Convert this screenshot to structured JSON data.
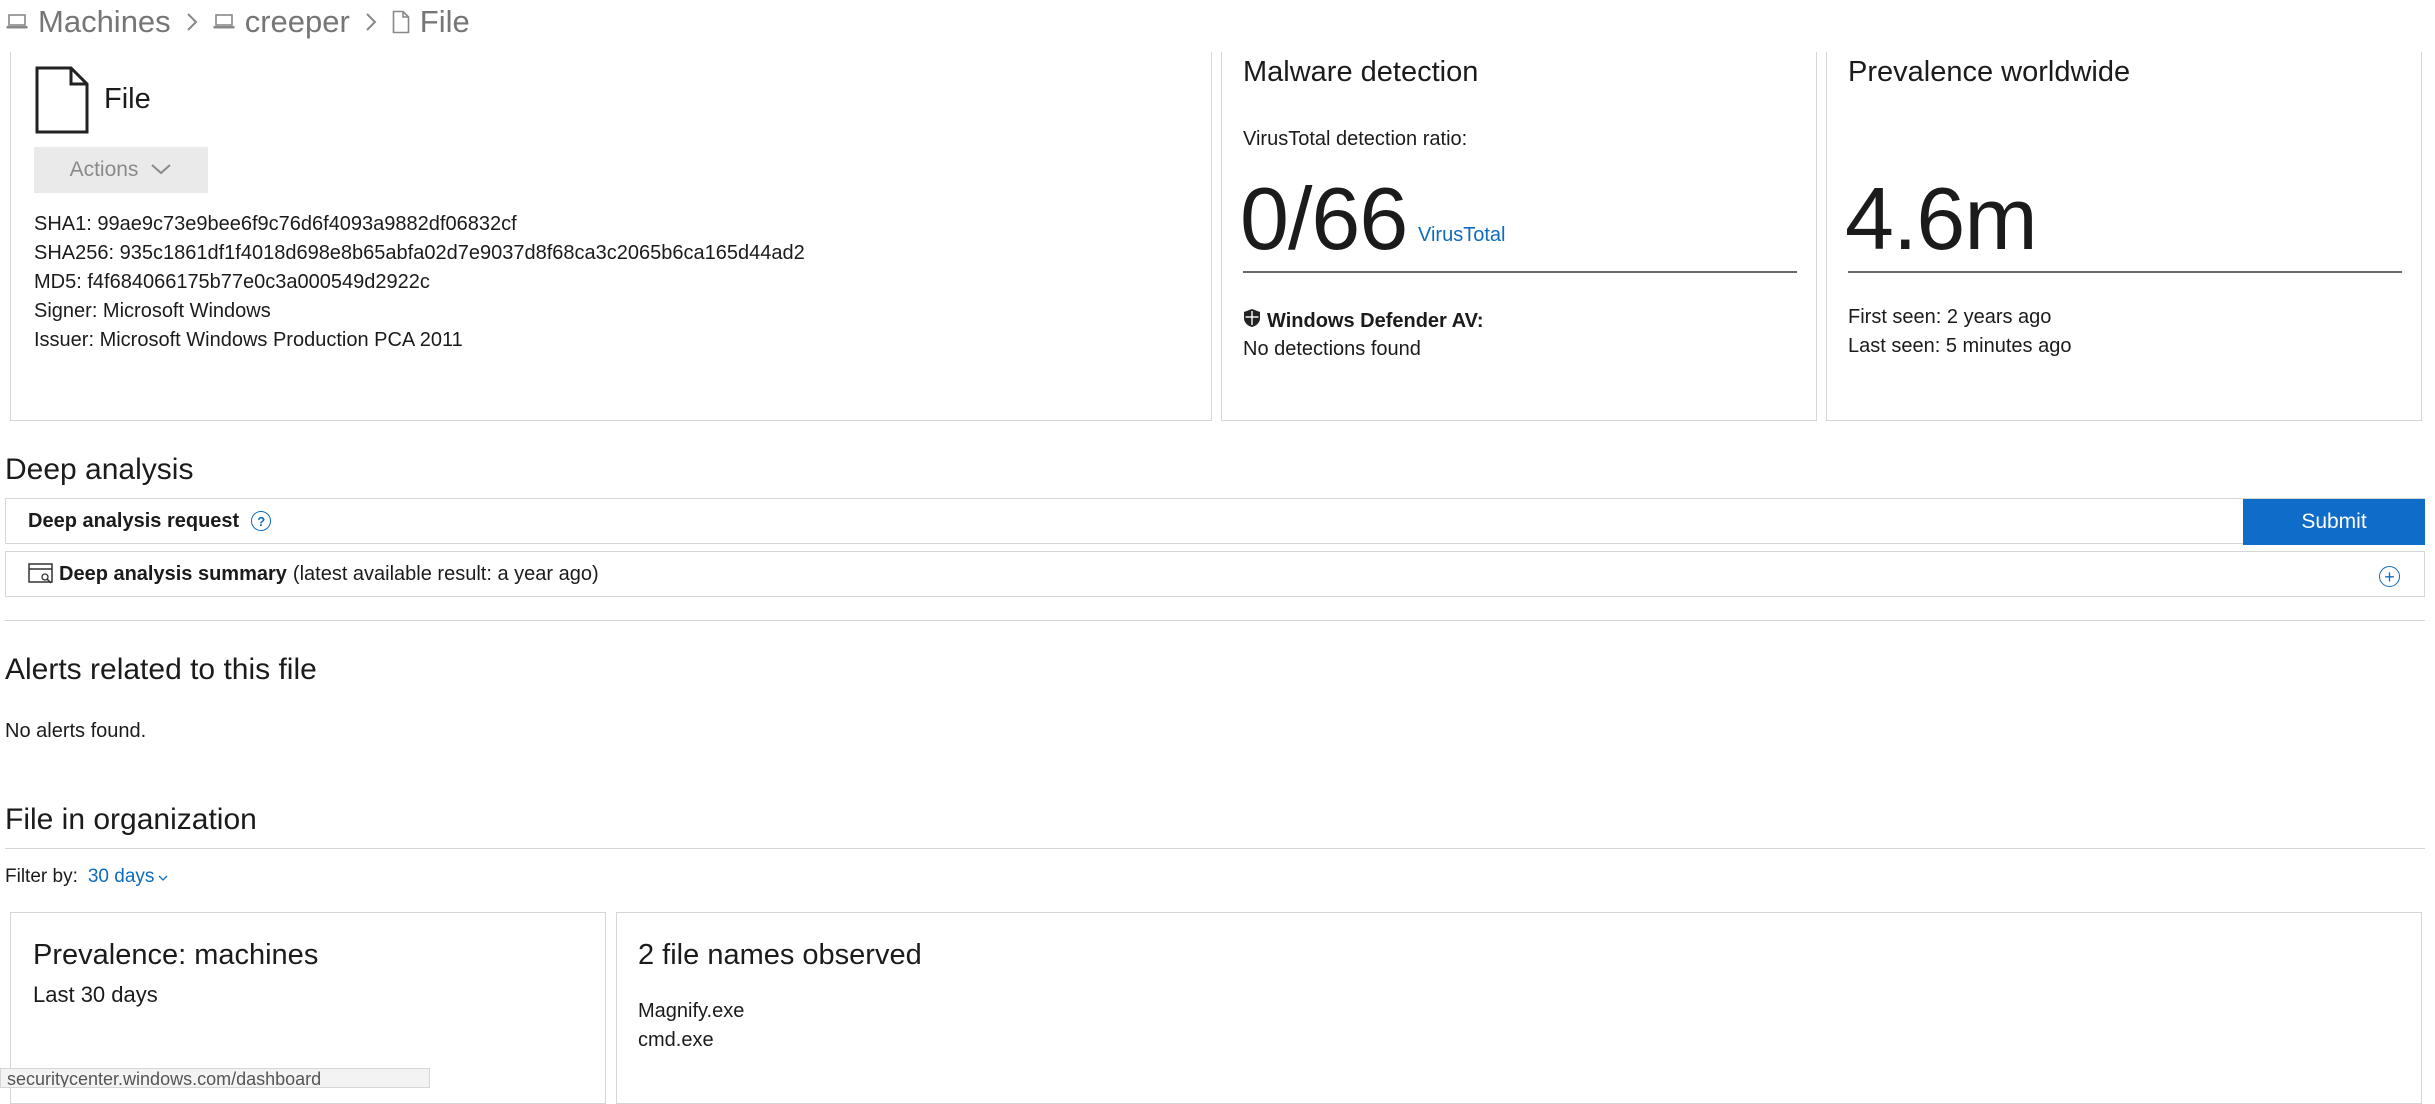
{
  "breadcrumb": {
    "items": [
      {
        "label": "Machines",
        "icon": "laptop-icon"
      },
      {
        "label": "creeper",
        "icon": "laptop-icon"
      },
      {
        "label": "File",
        "icon": "file-icon"
      }
    ]
  },
  "file_card": {
    "title": "File",
    "actions_label": "Actions",
    "details": [
      "SHA1: 99ae9c73e9bee6f9c76d6f4093a9882df06832cf",
      "SHA256: 935c1861df1f4018d698e8b65abfa02d7e9037d8f68ca3c2065b6ca165d44ad2",
      "MD5: f4f684066175b77e0c3a000549d2922c",
      "Signer: Microsoft Windows",
      "Issuer: Microsoft Windows Production PCA 2011"
    ]
  },
  "malware_card": {
    "title": "Malware detection",
    "ratio_label": "VirusTotal detection ratio:",
    "ratio_value": "0/66",
    "virustotal_link": "VirusTotal",
    "defender_label": "Windows Defender AV:",
    "defender_result": "No detections found"
  },
  "prevalence_card": {
    "title": "Prevalence worldwide",
    "value": "4.6m",
    "first_seen": "First seen: 2 years ago",
    "last_seen": "Last seen: 5 minutes ago"
  },
  "deep_analysis": {
    "section_title": "Deep analysis",
    "request_label": "Deep analysis request",
    "submit_label": "Submit",
    "summary_label": "Deep analysis summary",
    "summary_note": "(latest available result: a year ago)"
  },
  "alerts": {
    "section_title": "Alerts related to this file",
    "empty_text": "No alerts found."
  },
  "org": {
    "section_title": "File in organization",
    "filter_label": "Filter by:",
    "filter_value": "30 days",
    "machines_card": {
      "title": "Prevalence: machines",
      "subtitle": "Last 30 days"
    },
    "names_card": {
      "title": "2 file names observed",
      "names": [
        "Magnify.exe",
        "cmd.exe"
      ]
    }
  },
  "statusbar": {
    "url": "securitycenter.windows.com/dashboard"
  },
  "colors": {
    "accent": "#0f6cbd",
    "submit_bg": "#0f6cc8",
    "border": "#d6d6d6"
  }
}
